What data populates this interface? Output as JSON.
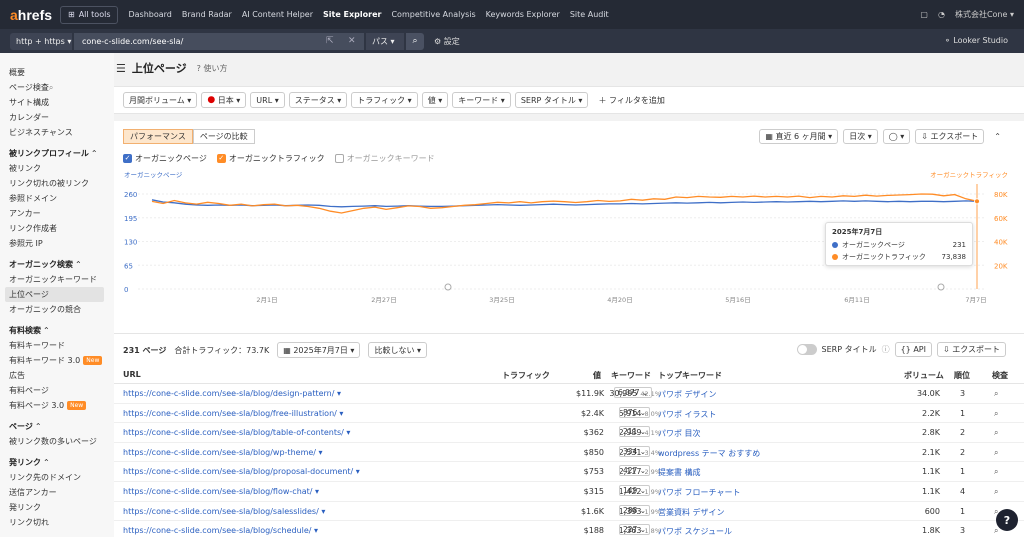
{
  "topnav": {
    "logo_a": "a",
    "logo_rest": "hrefs",
    "all_tools": "All tools",
    "items": [
      "Dashboard",
      "Brand Radar",
      "AI Content Helper",
      "Site Explorer",
      "Competitive Analysis",
      "Keywords Explorer",
      "Site Audit"
    ],
    "account": "株式会社Cone"
  },
  "urlbar": {
    "protocol": "http + https",
    "url": "cone-c-slide.com/see-sla/",
    "mode": "パス",
    "settings": "設定",
    "looker": "Looker Studio"
  },
  "sidebar": [
    {
      "type": "item",
      "label": "概要"
    },
    {
      "type": "item",
      "label": "ページ検査"
    },
    {
      "type": "item",
      "label": "サイト構成"
    },
    {
      "type": "item",
      "label": "カレンダー"
    },
    {
      "type": "item",
      "label": "ビジネスチャンス"
    },
    {
      "type": "head",
      "label": "被リンクプロフィール"
    },
    {
      "type": "item",
      "label": "被リンク"
    },
    {
      "type": "item",
      "label": "リンク切れの被リンク"
    },
    {
      "type": "item",
      "label": "参照ドメイン"
    },
    {
      "type": "item",
      "label": "アンカー"
    },
    {
      "type": "item",
      "label": "リンク作成者"
    },
    {
      "type": "item",
      "label": "参照元 IP"
    },
    {
      "type": "head",
      "label": "オーガニック検索"
    },
    {
      "type": "item",
      "label": "オーガニックキーワード"
    },
    {
      "type": "item",
      "label": "上位ページ",
      "active": true
    },
    {
      "type": "item",
      "label": "オーガニックの競合"
    },
    {
      "type": "head",
      "label": "有料検索"
    },
    {
      "type": "item",
      "label": "有料キーワード"
    },
    {
      "type": "item",
      "label": "有料キーワード 3.0",
      "badge": "New"
    },
    {
      "type": "item",
      "label": "広告"
    },
    {
      "type": "item",
      "label": "有料ページ"
    },
    {
      "type": "item",
      "label": "有料ページ 3.0",
      "badge": "New"
    },
    {
      "type": "head",
      "label": "ページ"
    },
    {
      "type": "item",
      "label": "被リンク数の多いページ"
    },
    {
      "type": "head",
      "label": "発リンク"
    },
    {
      "type": "item",
      "label": "リンク先のドメイン"
    },
    {
      "type": "item",
      "label": "送信アンカー"
    },
    {
      "type": "item",
      "label": "発リンク"
    },
    {
      "type": "item",
      "label": "リンク切れ"
    }
  ],
  "page": {
    "title": "上位ページ",
    "howto": "使い方"
  },
  "filters": {
    "items": [
      "月間ボリューム",
      "日本",
      "URL",
      "ステータス",
      "トラフィック",
      "値",
      "キーワード",
      "SERP タイトル"
    ],
    "add": "フィルタを追加"
  },
  "chart_panel": {
    "tabs": [
      "パフォーマンス",
      "ページの比較"
    ],
    "range": "直近 6 ヶ月間",
    "granularity": "日次",
    "export": "エクスポート",
    "legend": [
      "オーガニックページ",
      "オーガニックトラフィック",
      "オーガニックキーワード"
    ]
  },
  "chart_data": {
    "type": "line",
    "left_axis_label": "オーガニックページ",
    "right_axis_label": "オーガニックトラフィック",
    "left_ticks": [
      "260",
      "195",
      "130",
      "65",
      "0"
    ],
    "right_ticks": [
      "80K",
      "60K",
      "40K",
      "20K",
      ""
    ],
    "ylim_left": [
      0,
      260
    ],
    "ylim_right": [
      0,
      80000
    ],
    "x_ticks": [
      "2月1日",
      "2月27日",
      "3月25日",
      "4月20日",
      "5月16日",
      "6月11日",
      "7月7日"
    ],
    "series": [
      {
        "name": "オーガニックページ",
        "color": "#3f6fc7",
        "axis": "left",
        "values": [
          244,
          238,
          236,
          232,
          230,
          229,
          230,
          229,
          230,
          228,
          229,
          230,
          228,
          229,
          230,
          229,
          226,
          225,
          226,
          227,
          228,
          226,
          227,
          228,
          227,
          226,
          226,
          227,
          228,
          229,
          230,
          231,
          230,
          229,
          230,
          231,
          232,
          231,
          230,
          231,
          232,
          233,
          233,
          234,
          233,
          234,
          235,
          236,
          235,
          236,
          237,
          236,
          237,
          238,
          237,
          238,
          239,
          238,
          239,
          240,
          239,
          240,
          241,
          240,
          241,
          240,
          239,
          240,
          239,
          240,
          240,
          239,
          240,
          241,
          240
        ]
      },
      {
        "name": "オーガニックトラフィック",
        "color": "#ff8c26",
        "axis": "right",
        "values": [
          73800,
          72000,
          74500,
          72500,
          71500,
          73000,
          72000,
          70500,
          71500,
          70000,
          71000,
          71500,
          70000,
          70500,
          69500,
          68000,
          65500,
          64000,
          66000,
          68000,
          69000,
          67000,
          68500,
          70000,
          69500,
          68000,
          68500,
          69500,
          70500,
          71000,
          72000,
          73000,
          72500,
          73500,
          72500,
          73500,
          74000,
          73500,
          72800,
          73500,
          74500,
          73800,
          74200,
          75500,
          74800,
          76000,
          75500,
          77500,
          77000,
          78000,
          77500,
          77200,
          78000,
          77500,
          78200,
          77500,
          78000,
          77500,
          78200,
          77000,
          78000,
          77500,
          78500,
          78000,
          79000,
          78200,
          78800,
          79200,
          79500,
          80000,
          79800,
          78500,
          79500,
          76000,
          73838
        ]
      }
    ],
    "tooltip": {
      "title": "2025年7月7日",
      "rows": [
        {
          "label": "オーガニックページ",
          "value": "231",
          "color": "#3f6fc7"
        },
        {
          "label": "オーガニックトラフィック",
          "value": "73,838",
          "color": "#ff8c26"
        }
      ]
    }
  },
  "table": {
    "count": "231 ページ",
    "total_traffic": "合計トラフィック：73.7K",
    "date": "2025年7月7日",
    "compare": "比較しない",
    "serp_toggle": "SERP タイトル",
    "api": "API",
    "export": "エクスポート",
    "headers": {
      "url": "URL",
      "traffic": "トラフィック",
      "value": "値",
      "keywords": "キーワード",
      "top_kw": "トップキーワード",
      "volume": "ボリューム",
      "rank": "順位",
      "inspect": "検査"
    },
    "rows": [
      {
        "url": "https://cone-c-slide.com/see-sla/blog/design-pattern/",
        "traffic": "30,995",
        "pct": "42.1%",
        "value": "$11.9K",
        "kw": "6,077",
        "top": "パワポ デザイン",
        "vol": "34.0K",
        "rank": "3"
      },
      {
        "url": "https://cone-c-slide.com/see-sla/blog/free-illustration/",
        "traffic": "5,914",
        "pct": "8.0%",
        "value": "$2.4K",
        "kw": "876",
        "top": "パワポ イラスト",
        "vol": "2.2K",
        "rank": "1"
      },
      {
        "url": "https://cone-c-slide.com/see-sla/blog/table-of-contents/",
        "traffic": "2,989",
        "pct": "4.1%",
        "value": "$362",
        "kw": "211",
        "top": "パワポ 目次",
        "vol": "2.8K",
        "rank": "2"
      },
      {
        "url": "https://cone-c-slide.com/see-sla/blog/wp-theme/",
        "traffic": "2,531",
        "pct": "3.4%",
        "value": "$850",
        "kw": "334",
        "top": "wordpress テーマ おすすめ",
        "vol": "2.1K",
        "rank": "2"
      },
      {
        "url": "https://cone-c-slide.com/see-sla/blog/proposal-document/",
        "traffic": "2,117",
        "pct": "2.9%",
        "value": "$753",
        "kw": "427",
        "top": "提案書 構成",
        "vol": "1.1K",
        "rank": "1"
      },
      {
        "url": "https://cone-c-slide.com/see-sla/blog/flow-chat/",
        "traffic": "1,422",
        "pct": "1.9%",
        "value": "$315",
        "kw": "149",
        "top": "パワポ フローチャート",
        "vol": "1.1K",
        "rank": "4"
      },
      {
        "url": "https://cone-c-slide.com/see-sla/blog/salesslides/",
        "traffic": "1,393",
        "pct": "1.9%",
        "value": "$1.6K",
        "kw": "288",
        "top": "営業資料 デザイン",
        "vol": "600",
        "rank": "1"
      },
      {
        "url": "https://cone-c-slide.com/see-sla/blog/schedule/",
        "traffic": "1,363",
        "pct": "1.8%",
        "value": "$188",
        "kw": "227",
        "top": "パワポ スケジュール",
        "vol": "1.8K",
        "rank": "3"
      }
    ]
  }
}
